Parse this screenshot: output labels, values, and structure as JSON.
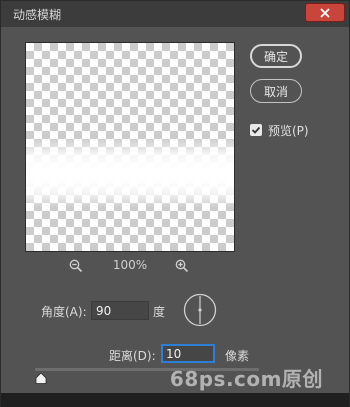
{
  "window": {
    "title": "动感模糊"
  },
  "buttons": {
    "ok": "确定",
    "cancel": "取消"
  },
  "preview_checkbox": {
    "label": "预览(P)",
    "checked": true
  },
  "zoom": {
    "level": "100%"
  },
  "angle": {
    "label": "角度(A):",
    "value": "90",
    "unit": "度"
  },
  "distance": {
    "label": "距离(D):",
    "value": "10",
    "unit": "像素",
    "slider_fraction": 0.01
  },
  "watermark": "68ps.com原创",
  "colors": {
    "close": "#c9443a",
    "focus": "#2d7fd6",
    "panel": "#535353"
  },
  "icons": {
    "close": "close-icon",
    "zoom_out": "zoom-out-icon",
    "zoom_in": "zoom-in-icon",
    "check": "check-icon"
  }
}
